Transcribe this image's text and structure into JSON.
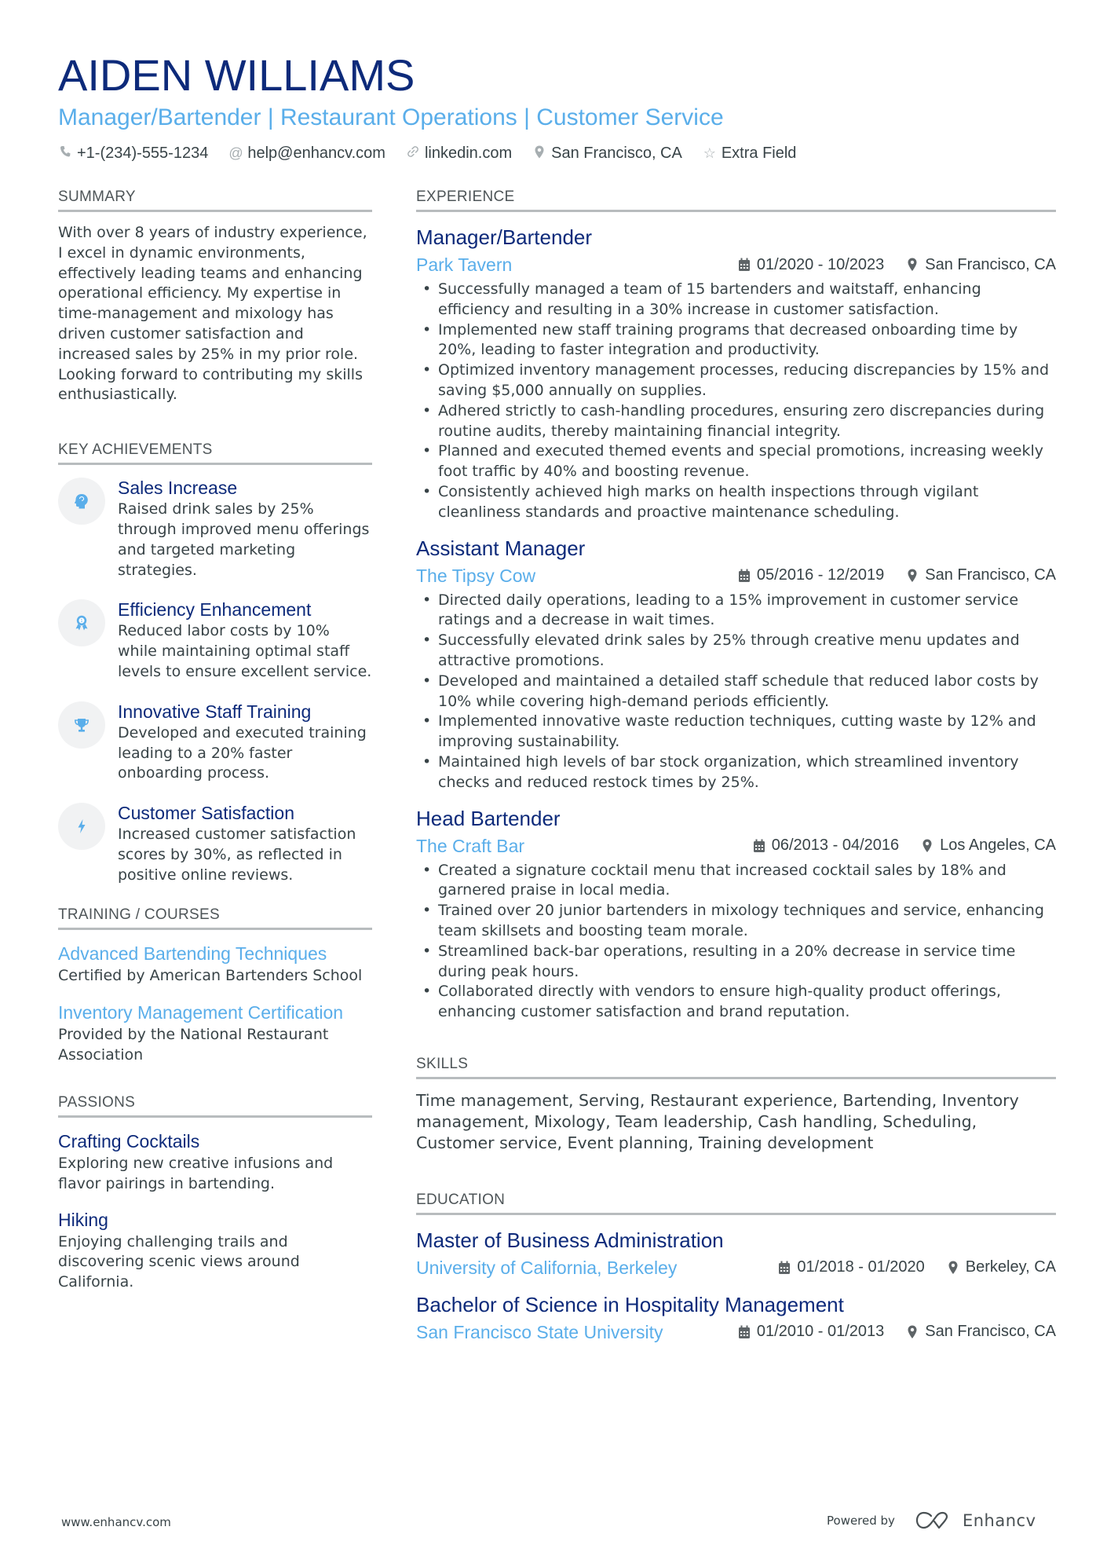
{
  "header": {
    "name": "AIDEN WILLIAMS",
    "subtitle": "Manager/Bartender | Restaurant Operations | Customer Service",
    "contacts": [
      {
        "icon": "phone-icon",
        "text": "+1-(234)-555-1234"
      },
      {
        "icon": "at-icon",
        "text": "help@enhancv.com"
      },
      {
        "icon": "link-icon",
        "text": "linkedin.com"
      },
      {
        "icon": "location-pin-icon",
        "text": "San Francisco, CA"
      },
      {
        "icon": "star-icon",
        "text": "Extra Field"
      }
    ]
  },
  "summary": {
    "title": "SUMMARY",
    "text": "With over 8 years of industry experience, I excel in dynamic environments, effectively leading teams and enhancing operational efficiency. My expertise in time-management and mixology has driven customer satisfaction and increased sales by 25% in my prior role. Looking forward to contributing my skills enthusiastically."
  },
  "achievements": {
    "title": "KEY ACHIEVEMENTS",
    "items": [
      {
        "icon": "head-brain-icon",
        "title": "Sales Increase",
        "text": "Raised drink sales by 25% through improved menu offerings and targeted marketing strategies."
      },
      {
        "icon": "award-ribbon-icon",
        "title": "Efficiency Enhancement",
        "text": "Reduced labor costs by 10% while maintaining optimal staff levels to ensure excellent service."
      },
      {
        "icon": "trophy-icon",
        "title": "Innovative Staff Training",
        "text": "Developed and executed training leading to a 20% faster onboarding process."
      },
      {
        "icon": "lightning-bolt-icon",
        "title": "Customer Satisfaction",
        "text": "Increased customer satisfaction scores by 30%, as reflected in positive online reviews."
      }
    ]
  },
  "training": {
    "title": "TRAINING / COURSES",
    "items": [
      {
        "title": "Advanced Bartending Techniques",
        "text": "Certified by American Bartenders School"
      },
      {
        "title": "Inventory Management Certification",
        "text": "Provided by the National Restaurant Association"
      }
    ]
  },
  "passions": {
    "title": "PASSIONS",
    "items": [
      {
        "title": "Crafting Cocktails",
        "text": "Exploring new creative infusions and flavor pairings in bartending."
      },
      {
        "title": "Hiking",
        "text": "Enjoying challenging trails and discovering scenic views around California."
      }
    ]
  },
  "experience": {
    "title": "EXPERIENCE",
    "jobs": [
      {
        "title": "Manager/Bartender",
        "company": "Park Tavern",
        "dates": "01/2020 - 10/2023",
        "location": "San Francisco, CA",
        "bullets": [
          "Successfully managed a team of 15 bartenders and waitstaff, enhancing efficiency and resulting in a 30% increase in customer satisfaction.",
          "Implemented new staff training programs that decreased onboarding time by 20%, leading to faster integration and productivity.",
          "Optimized inventory management processes, reducing discrepancies by 15% and saving $5,000 annually on supplies.",
          "Adhered strictly to cash-handling procedures, ensuring zero discrepancies during routine audits, thereby maintaining financial integrity.",
          "Planned and executed themed events and special promotions, increasing weekly foot traffic by 40% and boosting revenue.",
          "Consistently achieved high marks on health inspections through vigilant cleanliness standards and proactive maintenance scheduling."
        ]
      },
      {
        "title": "Assistant Manager",
        "company": "The Tipsy Cow",
        "dates": "05/2016 - 12/2019",
        "location": "San Francisco, CA",
        "bullets": [
          "Directed daily operations, leading to a 15% improvement in customer service ratings and a decrease in wait times.",
          "Successfully elevated drink sales by 25% through creative menu updates and attractive promotions.",
          "Developed and maintained a detailed staff schedule that reduced labor costs by 10% while covering high-demand periods efficiently.",
          "Implemented innovative waste reduction techniques, cutting waste by 12% and improving sustainability.",
          "Maintained high levels of bar stock organization, which streamlined inventory checks and reduced restock times by 25%."
        ]
      },
      {
        "title": "Head Bartender",
        "company": "The Craft Bar",
        "dates": "06/2013 - 04/2016",
        "location": "Los Angeles, CA",
        "bullets": [
          "Created a signature cocktail menu that increased cocktail sales by 18% and garnered praise in local media.",
          "Trained over 20 junior bartenders in mixology techniques and service, enhancing team skillsets and boosting team morale.",
          "Streamlined back-bar operations, resulting in a 20% decrease in service time during peak hours.",
          "Collaborated directly with vendors to ensure high-quality product offerings, enhancing customer satisfaction and brand reputation."
        ]
      }
    ]
  },
  "skills": {
    "title": "SKILLS",
    "text": "Time management, Serving, Restaurant experience, Bartending, Inventory management, Mixology, Team leadership, Cash handling, Scheduling, Customer service, Event planning, Training development"
  },
  "education": {
    "title": "EDUCATION",
    "items": [
      {
        "degree": "Master of Business Administration",
        "school": "University of California, Berkeley",
        "dates": "01/2018 - 01/2020",
        "location": "Berkeley, CA"
      },
      {
        "degree": "Bachelor of Science in Hospitality Management",
        "school": "San Francisco State University",
        "dates": "01/2010 - 01/2013",
        "location": "San Francisco, CA"
      }
    ]
  },
  "footer": {
    "website": "www.enhancv.com",
    "powered_by": "Powered by",
    "brand": "Enhancv"
  },
  "colors": {
    "name": "#0d2a7a",
    "accent": "#5aaeea",
    "text": "#384347",
    "rule": "#b8bcbe"
  }
}
